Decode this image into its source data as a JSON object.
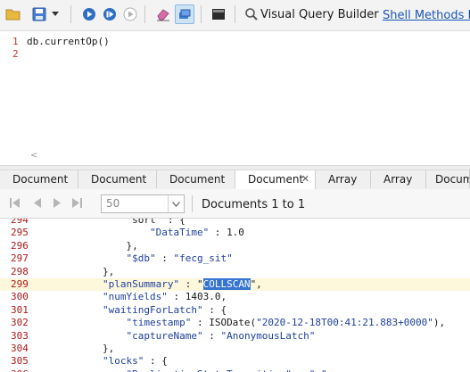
{
  "toolbar": {
    "query_builder_label": "Visual Query Builder",
    "shell_methods_label": "Shell Methods Re",
    "colors": {
      "link": "#1a56b8",
      "accent": "#2d6fc4"
    }
  },
  "editor": {
    "lines": [
      {
        "num": "1",
        "text": "db.currentOp()"
      },
      {
        "num": "2",
        "text": ""
      }
    ],
    "scroll_arrow": "<"
  },
  "tabs": [
    {
      "label": "Document"
    },
    {
      "label": "Document"
    },
    {
      "label": "Document"
    },
    {
      "label": "Document",
      "close": "✕"
    },
    {
      "label": "Array"
    },
    {
      "label": "Array"
    },
    {
      "label": "Docum"
    }
  ],
  "navbar": {
    "page_size": "50",
    "count_label": "Documents 1 to 1"
  },
  "result": {
    "lines": [
      {
        "num": "294",
        "parts": [
          {
            "t": "            \"sort\" : {",
            "c": "p"
          }
        ]
      },
      {
        "num": "295",
        "parts": [
          {
            "t": "                \"DataTime\"",
            "c": "k"
          },
          {
            "t": " : ",
            "c": "p"
          },
          {
            "t": "1.0",
            "c": "n"
          }
        ]
      },
      {
        "num": "296",
        "parts": [
          {
            "t": "            },",
            "c": "p"
          }
        ]
      },
      {
        "num": "297",
        "parts": [
          {
            "t": "            \"$db\"",
            "c": "k"
          },
          {
            "t": " : ",
            "c": "p"
          },
          {
            "t": "\"fecg_sit\"",
            "c": "s"
          }
        ]
      },
      {
        "num": "298",
        "parts": [
          {
            "t": "        },",
            "c": "p"
          }
        ]
      },
      {
        "num": "299",
        "hl": true,
        "parts": [
          {
            "t": "        \"planSummary\"",
            "c": "k"
          },
          {
            "t": " : \"",
            "c": "p"
          },
          {
            "t": "COLLSCAN",
            "c": "sel"
          },
          {
            "t": "\",",
            "c": "p"
          }
        ]
      },
      {
        "num": "300",
        "parts": [
          {
            "t": "        \"numYields\"",
            "c": "k"
          },
          {
            "t": " : ",
            "c": "p"
          },
          {
            "t": "1403.0",
            "c": "n"
          },
          {
            "t": ",",
            "c": "p"
          }
        ]
      },
      {
        "num": "301",
        "parts": [
          {
            "t": "        \"waitingForLatch\"",
            "c": "k"
          },
          {
            "t": " : {",
            "c": "p"
          }
        ]
      },
      {
        "num": "302",
        "parts": [
          {
            "t": "            \"timestamp\"",
            "c": "k"
          },
          {
            "t": " : ISODate(",
            "c": "p"
          },
          {
            "t": "\"2020-12-18T00:41:21.883+0000\"",
            "c": "s"
          },
          {
            "t": "),",
            "c": "p"
          }
        ]
      },
      {
        "num": "303",
        "parts": [
          {
            "t": "            \"captureName\"",
            "c": "k"
          },
          {
            "t": " : ",
            "c": "p"
          },
          {
            "t": "\"AnonymousLatch\"",
            "c": "s"
          }
        ]
      },
      {
        "num": "304",
        "parts": [
          {
            "t": "        },",
            "c": "p"
          }
        ]
      },
      {
        "num": "305",
        "parts": [
          {
            "t": "        \"locks\"",
            "c": "k"
          },
          {
            "t": " : {",
            "c": "p"
          }
        ]
      },
      {
        "num": "306",
        "parts": [
          {
            "t": "            \"ReplicationStateTransition\" : \"w\",",
            "c": "k"
          }
        ]
      }
    ]
  }
}
